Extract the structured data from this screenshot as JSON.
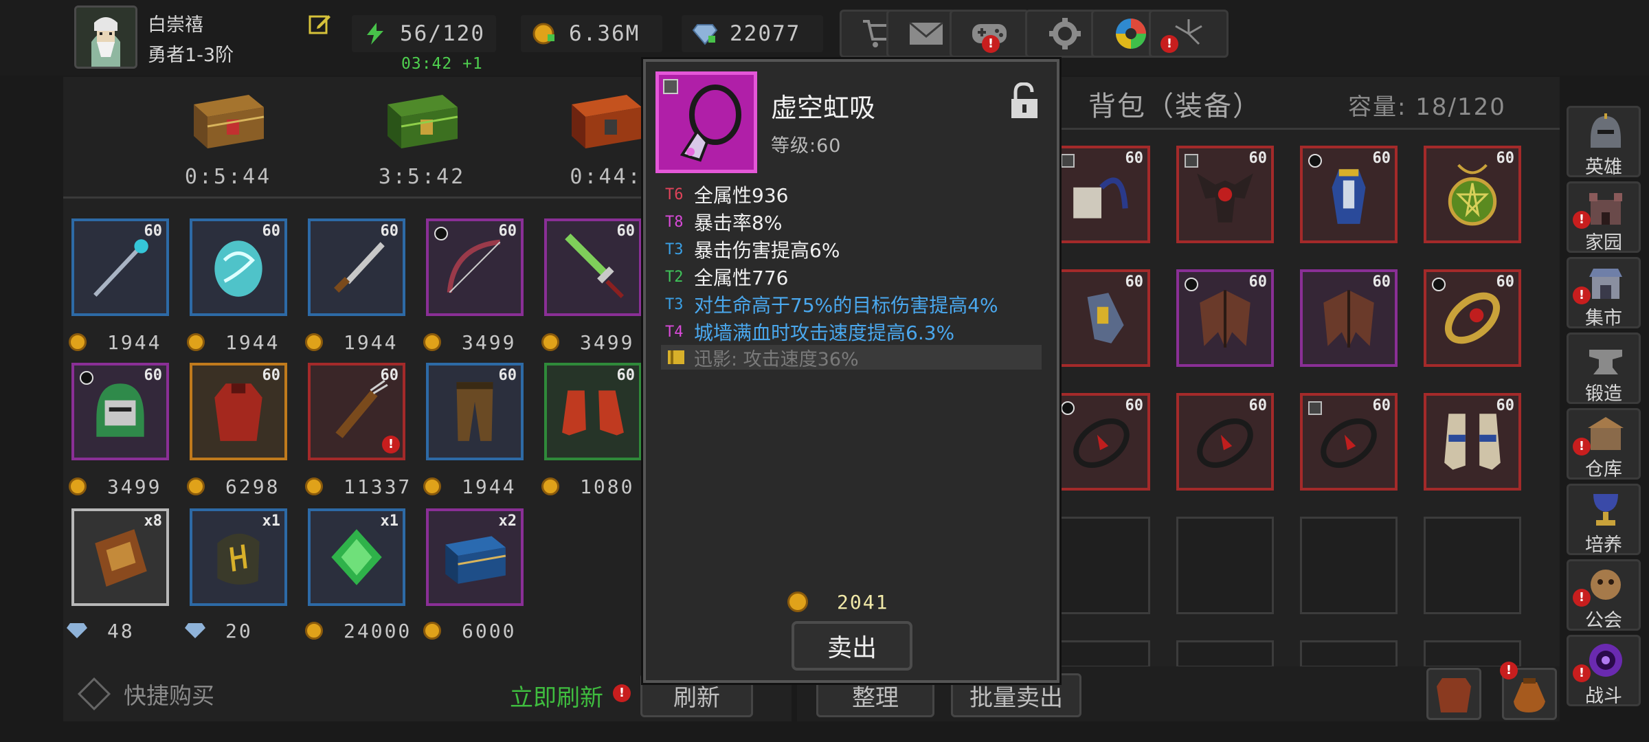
{
  "player": {
    "name": "白崇禧",
    "rank": "勇者1-3阶"
  },
  "resources": {
    "energy": "56/120",
    "energy_timer": "03:42 +1",
    "gold": "6.36M",
    "gems": "22077"
  },
  "top_buttons": [
    {
      "icon": "cart-icon",
      "alert": false
    },
    {
      "icon": "mail-icon",
      "alert": false
    },
    {
      "icon": "gamepad-icon",
      "alert": true
    },
    {
      "icon": "gear-icon",
      "alert": false
    },
    {
      "icon": "color-wheel-icon",
      "alert": false
    },
    {
      "icon": "fireworks-icon",
      "alert": true
    }
  ],
  "shop": {
    "chest_timers": [
      "0:5:44",
      "3:5:42",
      "0:44:"
    ],
    "rows": [
      [
        {
          "level": "60",
          "price": "1944",
          "currency": "gold",
          "rarity": "blue"
        },
        {
          "level": "60",
          "price": "1944",
          "currency": "gold",
          "rarity": "blue"
        },
        {
          "level": "60",
          "price": "1944",
          "currency": "gold",
          "rarity": "blue"
        },
        {
          "level": "60",
          "price": "3499",
          "currency": "gold",
          "rarity": "purple"
        },
        {
          "level": "60",
          "price": "3499",
          "currency": "gold",
          "rarity": "purple"
        }
      ],
      [
        {
          "level": "60",
          "price": "3499",
          "currency": "gold",
          "rarity": "purple"
        },
        {
          "level": "60",
          "price": "6298",
          "currency": "gold",
          "rarity": "orange"
        },
        {
          "level": "60",
          "price": "11337",
          "currency": "gold",
          "rarity": "red"
        },
        {
          "level": "60",
          "price": "1944",
          "currency": "gold",
          "rarity": "blue"
        },
        {
          "level": "60",
          "price": "1080",
          "currency": "gold",
          "rarity": "green"
        }
      ],
      [
        {
          "level": "x8",
          "price": "48",
          "currency": "gem",
          "rarity": "white"
        },
        {
          "level": "x1",
          "price": "20",
          "currency": "gem",
          "rarity": "blue"
        },
        {
          "level": "x1",
          "price": "24000",
          "currency": "gold",
          "rarity": "blue"
        },
        {
          "level": "x2",
          "price": "6000",
          "currency": "gold",
          "rarity": "purple"
        }
      ]
    ],
    "quick_buy_label": "快捷购买",
    "refresh_now_label": "立即刷新",
    "refresh_label": "刷新"
  },
  "bag": {
    "title": "背包（装备）",
    "capacity_label": "容量: 18/120",
    "level": "60",
    "sort_label": "整理",
    "bulk_sell_label": "批量卖出"
  },
  "sidenav": [
    {
      "label": "英雄",
      "icon": "helmet-icon",
      "alert": false
    },
    {
      "label": "家园",
      "icon": "castle-icon",
      "alert": true
    },
    {
      "label": "集市",
      "icon": "market-icon",
      "alert": true
    },
    {
      "label": "锻造",
      "icon": "anvil-icon",
      "alert": false
    },
    {
      "label": "仓库",
      "icon": "warehouse-icon",
      "alert": true
    },
    {
      "label": "培养",
      "icon": "chalice-icon",
      "alert": false
    },
    {
      "label": "公会",
      "icon": "guild-icon",
      "alert": true
    },
    {
      "label": "战斗",
      "icon": "portal-icon",
      "alert": true
    }
  ],
  "item_popup": {
    "name": "虚空虹吸",
    "level": "等级:60",
    "affixes": [
      {
        "tier": "T6",
        "text": "全属性936",
        "tier_color": "#e0435a",
        "special": false
      },
      {
        "tier": "T8",
        "text": "暴击率8%",
        "tier_color": "#d84ad8",
        "special": false
      },
      {
        "tier": "T3",
        "text": "暴击伤害提高6%",
        "tier_color": "#3aa0e6",
        "special": false
      },
      {
        "tier": "T2",
        "text": "全属性776",
        "tier_color": "#3fc35a",
        "special": false
      },
      {
        "tier": "T3",
        "text": "对生命高于75%的目标伤害提高4%",
        "tier_color": "#3aa0e6",
        "special": true
      },
      {
        "tier": "T4",
        "text": "城墙满血时攻击速度提高6.3%",
        "tier_color": "#d84ad8",
        "special": true
      }
    ],
    "set_bonus": "迅影: 攻击速度36%",
    "price": "2041",
    "sell_label": "卖出"
  },
  "colors": {
    "gold": "#e0a21a",
    "alert": "#c81e1e",
    "refresh_green": "#3fbd3f",
    "epic_magenta": "#b01fa8"
  }
}
